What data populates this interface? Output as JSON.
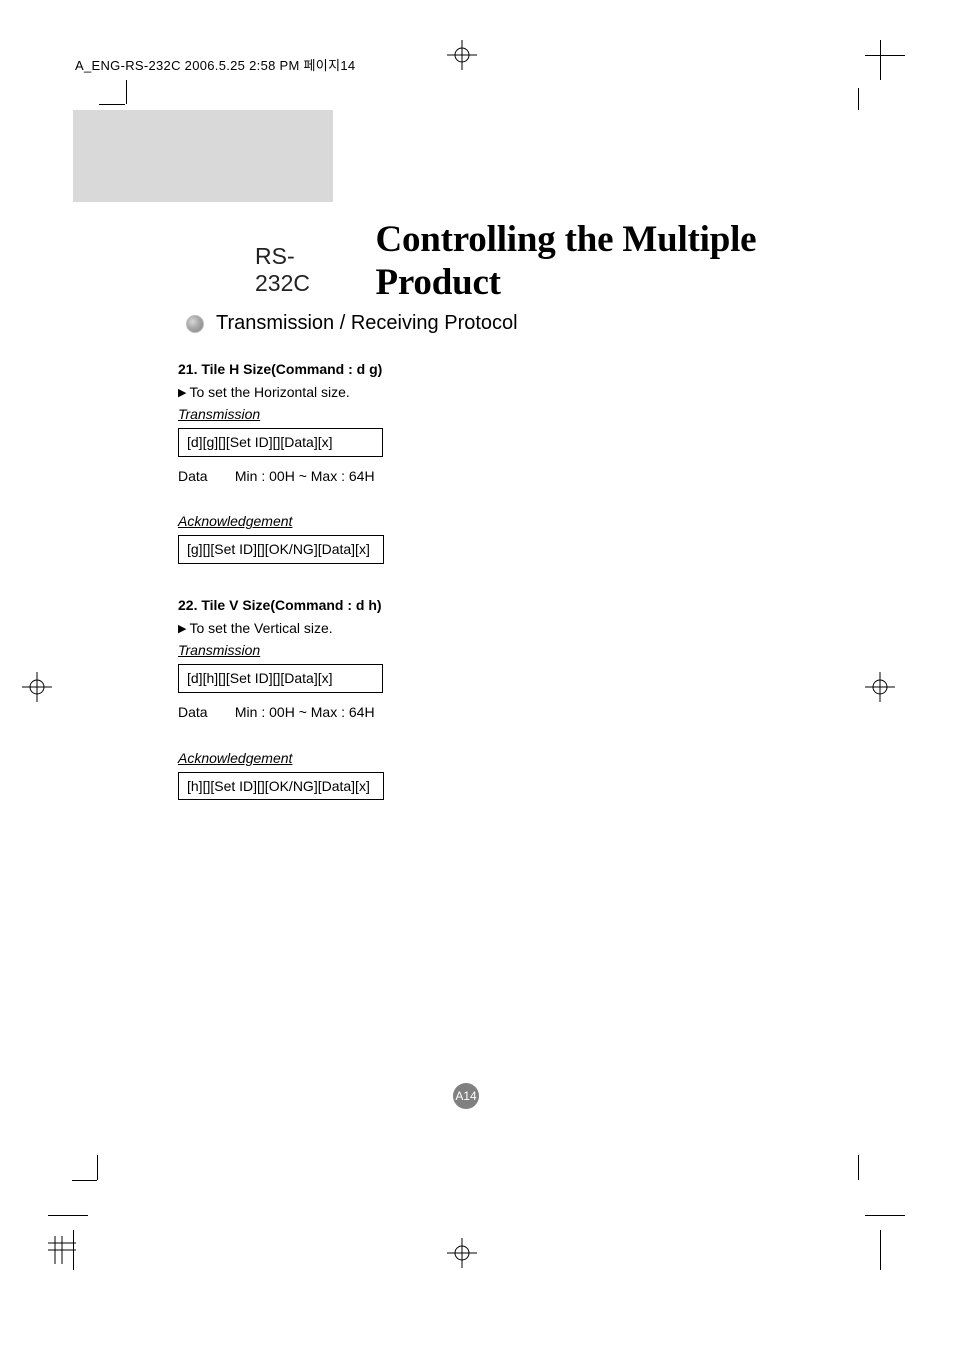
{
  "header": {
    "print_job": "A_ENG-RS-232C  2006.5.25  2:58 PM  페이지14"
  },
  "heading": {
    "rs_label": "RS-232C",
    "main_title": "Controlling the Multiple Product"
  },
  "section": {
    "protocol_title": "Transmission / Receiving Protocol"
  },
  "cmd21": {
    "title": "21. Tile H Size(Command : d g)",
    "desc": "To set the Horizontal size.",
    "transmission_label": "Transmission",
    "transmission_code": "[d][g][][Set ID][][Data][x]",
    "data_label": "Data",
    "data_range": "Min : 00H ~ Max : 64H",
    "ack_label": "Acknowledgement",
    "ack_code": "[g][][Set ID][][OK/NG][Data][x]"
  },
  "cmd22": {
    "title": "22. Tile V Size(Command : d h)",
    "desc": "To set the Vertical size.",
    "transmission_label": "Transmission",
    "transmission_code": "[d][h][][Set ID][][Data][x]",
    "data_label": "Data",
    "data_range": "Min : 00H ~ Max : 64H",
    "ack_label": "Acknowledgement",
    "ack_code": "[h][][Set ID][][OK/NG][Data][x]"
  },
  "page": {
    "number": "A14"
  }
}
